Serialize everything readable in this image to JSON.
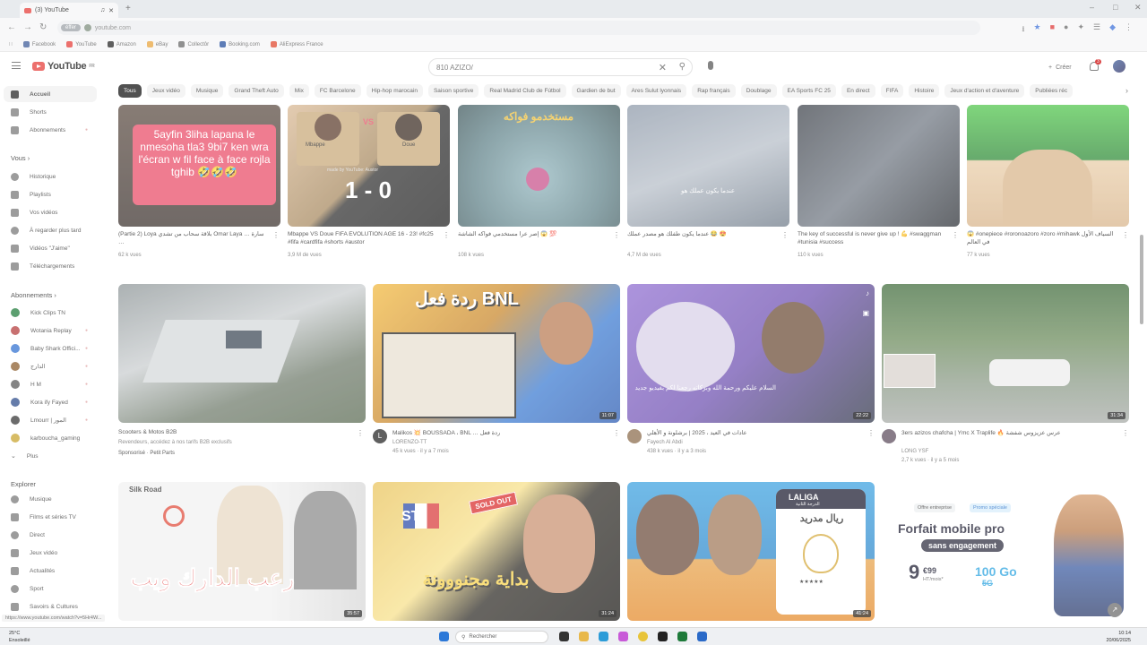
{
  "browser": {
    "tab_title": "(3) YouTube",
    "url": "youtube.com",
    "url_tag": "éffer",
    "bookmarks": [
      "Facebook",
      "YouTube",
      "Amazon",
      "eBay",
      "Collectôr",
      "Booking.com",
      "AliExpress France"
    ]
  },
  "header": {
    "logo_text": "YouTube",
    "logo_country": "FR",
    "search_value": "810 AZIZO/",
    "create_label": "Créer",
    "notifications_count": "3"
  },
  "sidebar": {
    "main": [
      {
        "label": "Accueil"
      },
      {
        "label": "Shorts"
      },
      {
        "label": "Abonnements"
      }
    ],
    "you_heading": "Vous",
    "you": [
      {
        "label": "Historique"
      },
      {
        "label": "Playlists"
      },
      {
        "label": "Vos vidéos"
      },
      {
        "label": "À regarder plus tard"
      },
      {
        "label": "Vidéos \"J'aime\""
      },
      {
        "label": "Téléchargements"
      }
    ],
    "subs_heading": "Abonnements",
    "subs": [
      {
        "label": "Kick Clips TN",
        "color": "#1e7a3a"
      },
      {
        "label": "Wotania Replay",
        "color": "#b33a3a"
      },
      {
        "label": "Baby Shark Offici...",
        "color": "#2f6fd0"
      },
      {
        "label": "الدارج",
        "color": "#8a5a2a"
      },
      {
        "label": "H M",
        "color": "#555555"
      },
      {
        "label": "Kora ify Fayed",
        "color": "#2a4a8a"
      },
      {
        "label": "Lmourr | المور",
        "color": "#333333"
      },
      {
        "label": "karboucha_gaming",
        "color": "#c8a22a"
      },
      {
        "label": "Plus"
      }
    ],
    "explore_heading": "Explorer",
    "explore": [
      {
        "label": "Musique"
      },
      {
        "label": "Films et séries TV"
      },
      {
        "label": "Direct"
      },
      {
        "label": "Jeux vidéo"
      },
      {
        "label": "Actualités"
      },
      {
        "label": "Sport"
      },
      {
        "label": "Savoirs & Cultures"
      }
    ]
  },
  "chips": [
    "Tous",
    "Jeux vidéo",
    "Musique",
    "Grand Theft Auto",
    "Mix",
    "FC Barcelone",
    "Hip-hop marocain",
    "Saison sportive",
    "Real Madrid Club de Fútbol",
    "Gardien de but",
    "Ares Sulut lyonnais",
    "Rap français",
    "Doublage",
    "EA Sports FC 25",
    "En direct",
    "FIFA",
    "Histoire",
    "Jeux d'action et d'aventure",
    "Publiées réc"
  ],
  "shorts": [
    {
      "title": "(Partie 2) Loya بلاقة سحاب من تشدي Omar Laya … سارة …",
      "views": "62 k vues",
      "overlay": "5ayfin 3liha lapana le nmesoha tla3 9bi7 ken wra l'écran w fil face à face rojla tghib 🤣🤣🤣"
    },
    {
      "title": "Mbappe VS Doue FIFA EVOLUTION AGE 16 - 23! #fc25 #fifa #cardfifa #shorts #austor",
      "views": "3,9 M de vues",
      "score": "1 - 0",
      "left_name": "Mbappe",
      "right_name": "Doue",
      "credit": "made by YouTube: Austor"
    },
    {
      "title": "إصر عرا مستخدمي فواكه الشاشة 😱 💯",
      "views": "108 k vues",
      "overlay": "مستخدمو فواكه"
    },
    {
      "title": "عندما يكون طفلك هو مصدر عملك 😂 😍",
      "views": "4,7 M de vues",
      "overlay": "عندما يكون عملك هو"
    },
    {
      "title": "The key of successful is never give up ! 💪 #swaggman #tunisia #success",
      "views": "110 k vues"
    },
    {
      "title": "😱 #onepiece #roronoazoro #zoro #mihawk السياف الأول في العالم",
      "views": "77 k vues"
    }
  ],
  "videos_row1": [
    {
      "title": "Scooters & Motos B2B",
      "channel": "Revendeurs, accédez à nos tarifs B2B exclusifs",
      "meta": "Sponsorisé · Petit Parts",
      "duration": "",
      "sponsored": true
    },
    {
      "title": "Malikos 💥 BOUSSADA ، BNL … ردة فعل",
      "channel": "LORENZO-TT",
      "meta": "45 k vues · il y a 7 mois",
      "duration": "11:07",
      "overlay": "ردة فعل BNL",
      "av_letter": "L"
    },
    {
      "title": "عادات في العيد ، 2025 | برشلونة و الأهلي",
      "channel": "Fayech Al Abdi",
      "meta": "438 k vues · il y a 3 mois",
      "duration": "22:22",
      "overlay": "السلام عليكم ورحمة الله وبركاته رجعنا لكم بفيديو جديد"
    },
    {
      "title": "3ers azizos chafcha | Ymc X Traplife 🔥 عرس عزيزوس شفشة",
      "channel": "LONG YSF",
      "meta": "2,7 k vues · il y a 5 mois",
      "duration": "31:34"
    }
  ],
  "videos_row2": [
    {
      "duration": "35:57",
      "overlay": "رعب الدارك ويب",
      "brand": "Silk Road"
    },
    {
      "duration": "31:24",
      "overlay": "بداية مجنووونة",
      "sticker": "SOLD OUT",
      "badge": "ST"
    },
    {
      "duration": "41:24",
      "overlay": "ريال مدريد",
      "league": "LALIGA",
      "league_sub": "الدرجة الثانية"
    }
  ],
  "ad": {
    "tag1": "Offre entreprise",
    "tag2": "Promo spéciale",
    "headline": "Forfait mobile pro",
    "subhead": "sans engagement",
    "price": "9",
    "price_cents": "€99",
    "price_unit": "HT/mois*",
    "data": "100 Go",
    "net": "5G"
  },
  "status_url": "https://www.youtube.com/watch?v=5Hr4W...",
  "taskbar": {
    "weather_temp": "25°C",
    "weather_desc": "Ensoleillé",
    "search_placeholder": "Rechercher",
    "time": "10:14",
    "date": "20/06/2025"
  },
  "colors": {
    "brand_red": "#e53935",
    "chip_active": "#0f0f0f"
  }
}
